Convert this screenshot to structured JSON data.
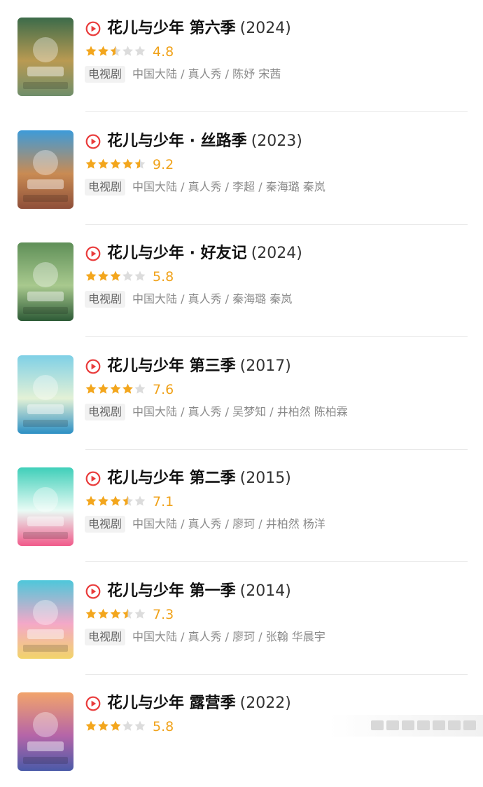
{
  "items": [
    {
      "title": "花儿与少年 第六季",
      "year": "(2024)",
      "rating": 4.8,
      "stars": 2.5,
      "type": "电视剧",
      "meta": "中国大陆 / 真人秀 / 陈妤 宋茜",
      "poster_colors": [
        "#3c6b4a",
        "#b99a52",
        "#6f8e6a"
      ]
    },
    {
      "title": "花儿与少年 · 丝路季",
      "year": "(2023)",
      "rating": 9.2,
      "stars": 4.5,
      "type": "电视剧",
      "meta": "中国大陆 / 真人秀 / 李超 / 秦海璐 秦岚",
      "poster_colors": [
        "#3d9bd9",
        "#c98b53",
        "#8e4f39"
      ]
    },
    {
      "title": "花儿与少年 · 好友记",
      "year": "(2024)",
      "rating": 5.8,
      "stars": 3,
      "type": "电视剧",
      "meta": "中国大陆 / 真人秀 / 秦海璐 秦岚",
      "poster_colors": [
        "#5f8f58",
        "#a8c98e",
        "#2d5a36"
      ]
    },
    {
      "title": "花儿与少年 第三季",
      "year": "(2017)",
      "rating": 7.6,
      "stars": 4,
      "type": "电视剧",
      "meta": "中国大陆 / 真人秀 / 吴梦知 / 井柏然 陈柏霖",
      "poster_colors": [
        "#7fd0e6",
        "#e3f1d6",
        "#2c8fc4"
      ]
    },
    {
      "title": "花儿与少年 第二季",
      "year": "(2015)",
      "rating": 7.1,
      "stars": 3.5,
      "type": "电视剧",
      "meta": "中国大陆 / 真人秀 / 廖珂 / 井柏然 杨洋",
      "poster_colors": [
        "#3fcfb9",
        "#e9fbf5",
        "#f05a8a"
      ]
    },
    {
      "title": "花儿与少年 第一季",
      "year": "(2014)",
      "rating": 7.3,
      "stars": 3.5,
      "type": "电视剧",
      "meta": "中国大陆 / 真人秀 / 廖珂 / 张翰 华晨宇",
      "poster_colors": [
        "#4ec7da",
        "#f4a8c8",
        "#f2d46a"
      ]
    },
    {
      "title": "花儿与少年 露营季",
      "year": "(2022)",
      "rating": 5.8,
      "stars": 3,
      "type": "电视剧",
      "meta": "",
      "poster_colors": [
        "#f2a46b",
        "#b565a8",
        "#4a5aa8"
      ]
    }
  ],
  "colors": {
    "accent_red": "#e93b3b",
    "star_filled": "#f3a61d",
    "star_empty": "#dcdcdc",
    "score": "#f0a21a"
  },
  "icons": {
    "play": "play-circle-icon",
    "star": "star-icon"
  }
}
